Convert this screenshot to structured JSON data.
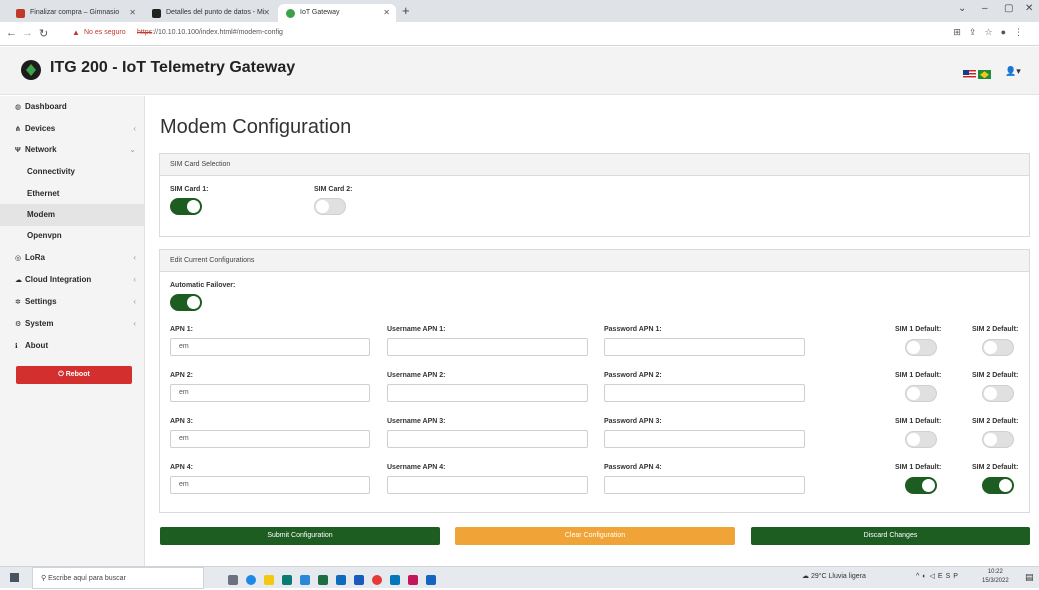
{
  "browser": {
    "tabs": [
      {
        "title": "Finalizar compra – Gimnasio"
      },
      {
        "title": "Detalles del punto de datos - Mi"
      },
      {
        "title": "IoT Gateway"
      }
    ],
    "security_warning": "No es seguro",
    "url_scheme": "https",
    "url_rest": "://10.10.10.100/index.html#/modem-config"
  },
  "header": {
    "title": "ITG 200 - IoT Telemetry Gateway"
  },
  "sidebar": {
    "items": [
      {
        "label": "Dashboard"
      },
      {
        "label": "Devices"
      },
      {
        "label": "Network"
      },
      {
        "label": "Connectivity"
      },
      {
        "label": "Ethernet"
      },
      {
        "label": "Modem"
      },
      {
        "label": "Openvpn"
      },
      {
        "label": "LoRa"
      },
      {
        "label": "Cloud Integration"
      },
      {
        "label": "Settings"
      },
      {
        "label": "System"
      },
      {
        "label": "About"
      }
    ],
    "reboot_label": "Reboot"
  },
  "page": {
    "title": "Modem Configuration",
    "sim_card": {
      "header": "SIM Card Selection",
      "sim1_label": "SIM Card 1:",
      "sim1_enabled": true,
      "sim2_label": "SIM Card 2:",
      "sim2_enabled": false
    },
    "edit": {
      "header": "Edit Current Configurations",
      "failover_label": "Automatic Failover:",
      "failover_enabled": true,
      "apns": [
        {
          "apn_label": "APN 1:",
          "apn_value": "em",
          "user_label": "Username APN 1:",
          "user_value": "",
          "pass_label": "Password APN 1:",
          "pass_value": "",
          "sim1_label": "SIM 1 Default:",
          "sim1_default": false,
          "sim2_label": "SIM 2 Default:",
          "sim2_default": false
        },
        {
          "apn_label": "APN 2:",
          "apn_value": "em",
          "user_label": "Username APN 2:",
          "user_value": "",
          "pass_label": "Password APN 2:",
          "pass_value": "",
          "sim1_label": "SIM 1 Default:",
          "sim1_default": false,
          "sim2_label": "SIM 2 Default:",
          "sim2_default": false
        },
        {
          "apn_label": "APN 3:",
          "apn_value": "em",
          "user_label": "Username APN 3:",
          "user_value": "",
          "pass_label": "Password APN 3:",
          "pass_value": "",
          "sim1_label": "SIM 1 Default:",
          "sim1_default": false,
          "sim2_label": "SIM 2 Default:",
          "sim2_default": false
        },
        {
          "apn_label": "APN 4:",
          "apn_value": "em",
          "user_label": "Username APN 4:",
          "user_value": "",
          "pass_label": "Password APN 4:",
          "pass_value": "",
          "sim1_label": "SIM 1 Default:",
          "sim1_default": true,
          "sim2_label": "SIM 2 Default:",
          "sim2_default": true
        }
      ]
    },
    "buttons": {
      "submit": "Submit Configuration",
      "clear": "Clear Configuration",
      "discard": "Discard Changes"
    }
  },
  "taskbar": {
    "search_placeholder": "Escribe aquí para buscar",
    "weather": "29°C Lluvia ligera",
    "language": "ESP",
    "time": "10:22",
    "date": "15/3/2022"
  },
  "colors": {
    "primary_green": "#1e5d22",
    "danger_red": "#d32f2f",
    "warning_orange": "#f0a437"
  }
}
